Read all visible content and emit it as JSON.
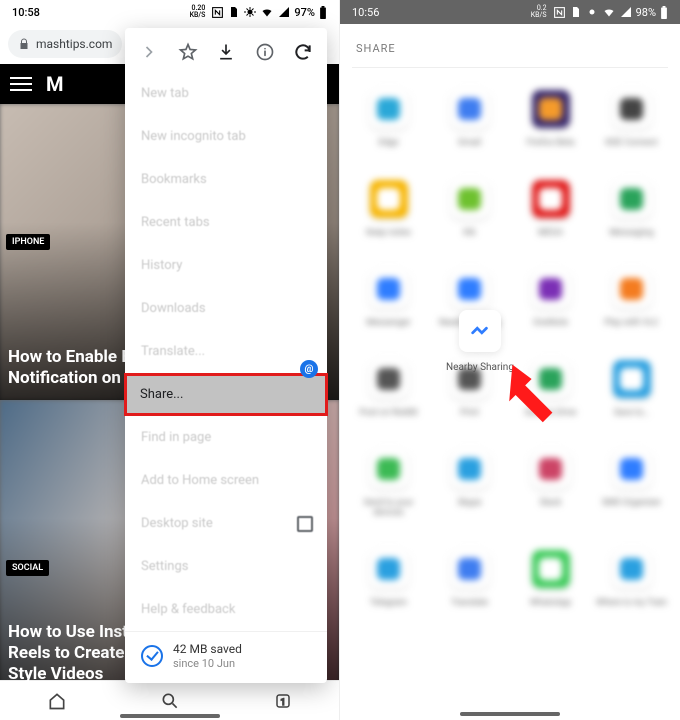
{
  "left": {
    "status": {
      "time": "10:58",
      "net": "0.20\nKB/S",
      "battery": "97%"
    },
    "url": "mashtips.com",
    "toolbar_logo_letter": "M",
    "articles": [
      {
        "tag": "IPHONE",
        "title": "How to Enable Back Tap Notification on iPhone"
      },
      {
        "tag": "SOCIAL",
        "title": "How to Use Instagram Reels to Create TikTok-Style Videos"
      }
    ],
    "menu": {
      "icons": [
        "forward",
        "star",
        "download",
        "info",
        "refresh"
      ],
      "items": [
        "New tab",
        "New incognito tab",
        "Bookmarks",
        "Recent tabs",
        "History",
        "Downloads",
        "Translate...",
        "Share...",
        "Find in page",
        "Add to Home screen",
        "Desktop site",
        "Settings",
        "Help & feedback"
      ],
      "highlight_index": 7,
      "checkbox_index": 10,
      "saved_line1": "42 MB saved",
      "saved_line2": "since 10 Jun"
    }
  },
  "right": {
    "status": {
      "time": "10:56",
      "net": "0.2\nKB/S",
      "battery": "98%"
    },
    "header": "SHARE",
    "apps": [
      {
        "label": "Edge",
        "color": "#fff",
        "inner": "#2aa8d8"
      },
      {
        "label": "Gmail",
        "color": "#fff",
        "inner": "#3f7df0"
      },
      {
        "label": "Firefox Beta",
        "color": "#3a2b6e",
        "inner": "#f59b2b"
      },
      {
        "label": "KDE Connect",
        "color": "#fff",
        "inner": "#444"
      },
      {
        "label": "Keep notes",
        "color": "#f7b500",
        "inner": "#fff"
      },
      {
        "label": "Kik",
        "color": "#fff",
        "inner": "#6ec12f"
      },
      {
        "label": "MEGA",
        "color": "#e11b1b",
        "inner": "#fff"
      },
      {
        "label": "Messaging",
        "color": "#fff",
        "inner": "#2aa35b"
      },
      {
        "label": "Messenger",
        "color": "#fff",
        "inner": "#2f7dff"
      },
      {
        "label": "Nearby Sharing",
        "color": "#fff",
        "inner": "#2f7dff"
      },
      {
        "label": "OneNote",
        "color": "#fff",
        "inner": "#7b2fb5"
      },
      {
        "label": "Play with VLC",
        "color": "#fff",
        "inner": "#f47c20"
      },
      {
        "label": "Post on Reddit",
        "color": "#fff",
        "inner": "#555"
      },
      {
        "label": "Print",
        "color": "#fff",
        "inner": "#555"
      },
      {
        "label": "Save to Drive",
        "color": "#fff",
        "inner": "#2aa35b"
      },
      {
        "label": "Save to…",
        "color": "#2aa0e0",
        "inner": "#fff"
      },
      {
        "label": "Send to your devices",
        "color": "#fff",
        "inner": "#3cba54"
      },
      {
        "label": "Skype",
        "color": "#fff",
        "inner": "#2aa0e0"
      },
      {
        "label": "Slack",
        "color": "#fff",
        "inner": "#cc4466"
      },
      {
        "label": "SMS Organizer",
        "color": "#fff",
        "inner": "#2f7dff"
      },
      {
        "label": "Telegram",
        "color": "#fff",
        "inner": "#2aa0e0"
      },
      {
        "label": "Translate",
        "color": "#fff",
        "inner": "#3f7df0"
      },
      {
        "label": "WhatsApp",
        "color": "#3ccb5a",
        "inner": "#fff"
      },
      {
        "label": "Where is my Train",
        "color": "#fff",
        "inner": "#2aa0e0"
      }
    ],
    "focus_app_index": 9
  }
}
